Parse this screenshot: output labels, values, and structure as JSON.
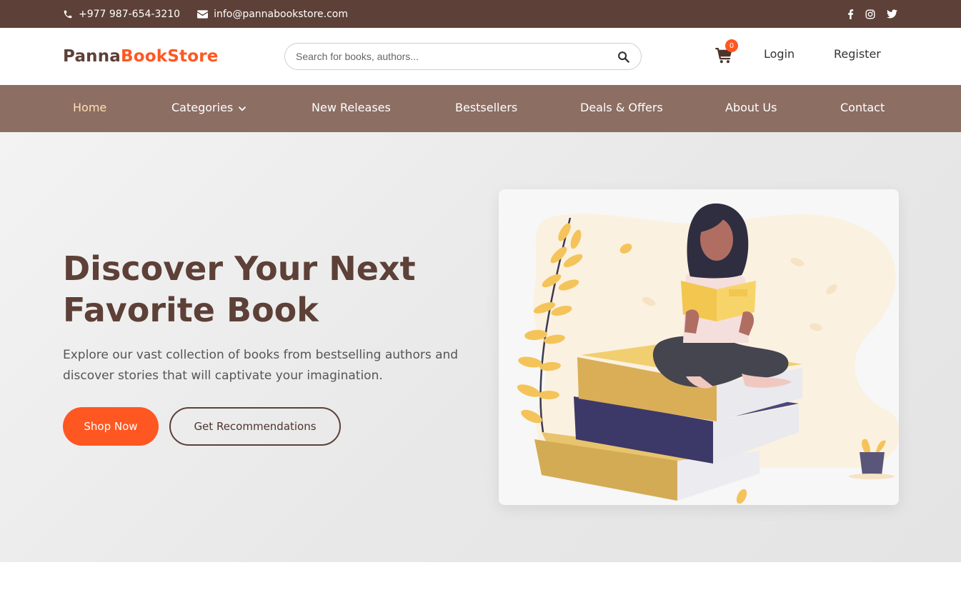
{
  "topbar": {
    "phone": "+977 987-654-3210",
    "email": "info@pannabookstore.com",
    "social": [
      "facebook-icon",
      "instagram-icon",
      "twitter-icon"
    ]
  },
  "header": {
    "logo_part1": "Panna",
    "logo_part2": "BookStore",
    "search_placeholder": "Search for books, authors...",
    "cart_count": "0",
    "login_label": "Login",
    "register_label": "Register"
  },
  "nav": {
    "items": [
      {
        "label": "Home",
        "active": true
      },
      {
        "label": "Categories"
      },
      {
        "label": "New Releases"
      },
      {
        "label": "Bestsellers"
      },
      {
        "label": "Deals & Offers"
      },
      {
        "label": "About Us"
      },
      {
        "label": "Contact"
      }
    ]
  },
  "hero": {
    "title": "Discover Your Next Favorite Book",
    "description": "Explore our vast collection of books from bestselling authors and discover stories that will captivate your imagination.",
    "primary_button": "Shop Now",
    "secondary_button": "Get Recommendations"
  },
  "colors": {
    "brand_brown": "#5d4037",
    "accent_orange": "#ff5722",
    "nav_bg": "#8d6e63",
    "nav_active": "#ffe0b2"
  }
}
